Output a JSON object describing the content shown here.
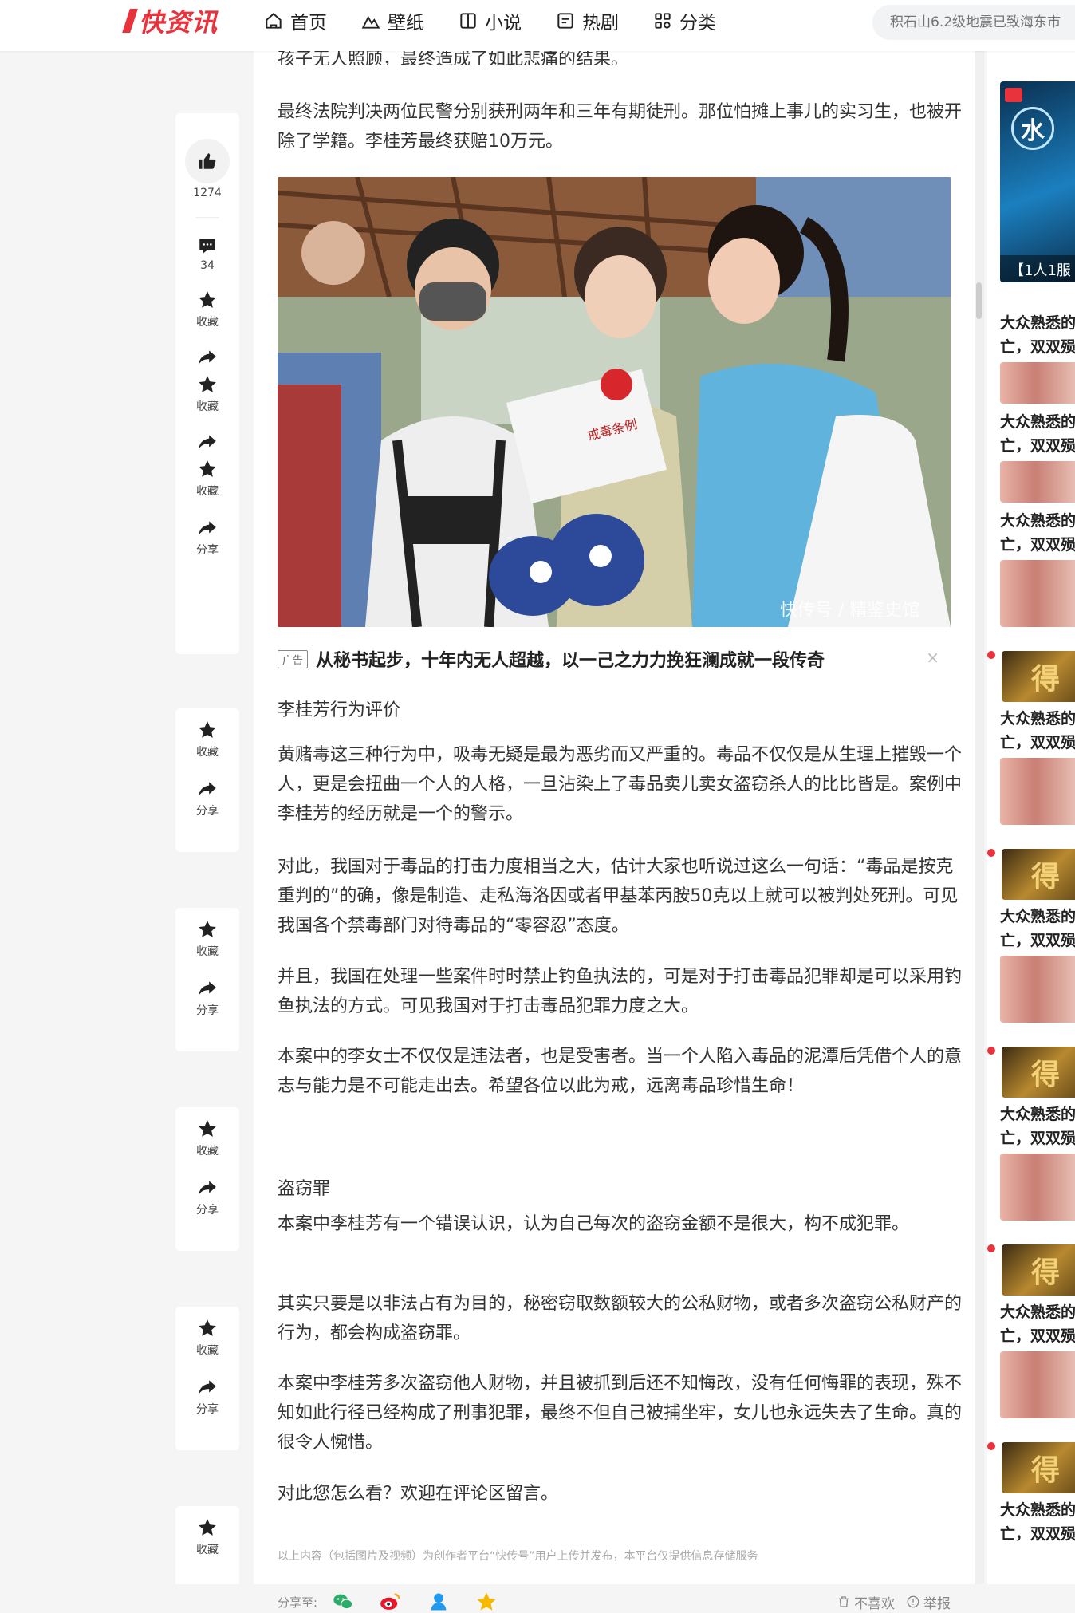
{
  "logo": "快资讯",
  "nav": [
    {
      "label": "首页",
      "icon": "home-icon"
    },
    {
      "label": "壁纸",
      "icon": "mountain-icon"
    },
    {
      "label": "小说",
      "icon": "book-icon"
    },
    {
      "label": "热剧",
      "icon": "film-icon"
    },
    {
      "label": "分类",
      "icon": "grid-icon"
    }
  ],
  "search": {
    "placeholder": "积石山6.2级地震已致海东市"
  },
  "sidebar": {
    "like_count": "1274",
    "comment_count": "34",
    "collect_label": "收藏",
    "share_label": "分享"
  },
  "article": {
    "cut_line": "孩子无人照顾，最终造成了如此悲痛的结果。",
    "p_verdict": "最终法院判决两位民警分别获刑两年和三年有期徒刑。那位怕摊上事儿的实习生，也被开除了学籍。李桂芳最终获赔10万元。",
    "photo_watermark": "快传号 / 精鉴史馆",
    "photo_booklet": "戒毒条例",
    "ad_tag": "广告",
    "ad_title": "从秘书起步，十年内无人超越，以一己之力力挽狂澜成就一段传奇",
    "ad_close": "×",
    "h_eval": "李桂芳行为评价",
    "p1": "黄赌毒这三种行为中，吸毒无疑是最为恶劣而又严重的。毒品不仅仅是从生理上摧毁一个人，更是会扭曲一个人的人格，一旦沾染上了毒品卖儿卖女盗窃杀人的比比皆是。案例中李桂芳的经历就是一个的警示。",
    "p2": "对此，我国对于毒品的打击力度相当之大，估计大家也听说过这么一句话：“毒品是按克重判的”的确，像是制造、走私海洛因或者甲基苯丙胺50克以上就可以被判处死刑。可见我国各个禁毒部门对待毒品的“零容忍”态度。",
    "p3": "并且，我国在处理一些案件时时禁止钓鱼执法的，可是对于打击毒品犯罪却是可以采用钓鱼执法的方式。可见我国对于打击毒品犯罪力度之大。",
    "p4": "本案中的李女士不仅仅是违法者，也是受害者。当一个人陷入毒品的泥潭后凭借个人的意志与能力是不可能走出去。希望各位以此为戒，远离毒品珍惜生命！",
    "h_theft": "盗窃罪",
    "p5": "本案中李桂芳有一个错误认识，认为自己每次的盗窃金额不是很大，构不成犯罪。",
    "p6": "其实只要是以非法占有为目的，秘密窃取数额较大的公私财物，或者多次盗窃公私财产的行为，都会构成盗窃罪。",
    "p7": "本案中李桂芳多次盗窃他人财物，并且被抓到后还不知悔改，没有任何悔罪的表现，殊不知如此行径已经构成了刑事犯罪，最终不但自己被捕坐牢，女儿也永远失去了生命。真的很令人惋惜。",
    "p8": "对此您怎么看？欢迎在评论区留言。",
    "footer_note": "以上内容（包括图片及视频）为创作者平台“快传号”用户上传并发布，本平台仅提供信息存储服务",
    "share_label": "分享至:",
    "dislike_label": "不喜欢",
    "report_label": "举报"
  },
  "right": {
    "banner_char": "水",
    "banner_caption": "【1人1服",
    "item_line1": "大众熟悉的",
    "item_line2": "亡，双双殒",
    "promo_char": "得"
  },
  "colors": {
    "brand": "#e8323c",
    "wechat": "#2aae67",
    "weibo": "#e6162d",
    "qq": "#1e9bf0",
    "star": "#f5b800"
  }
}
